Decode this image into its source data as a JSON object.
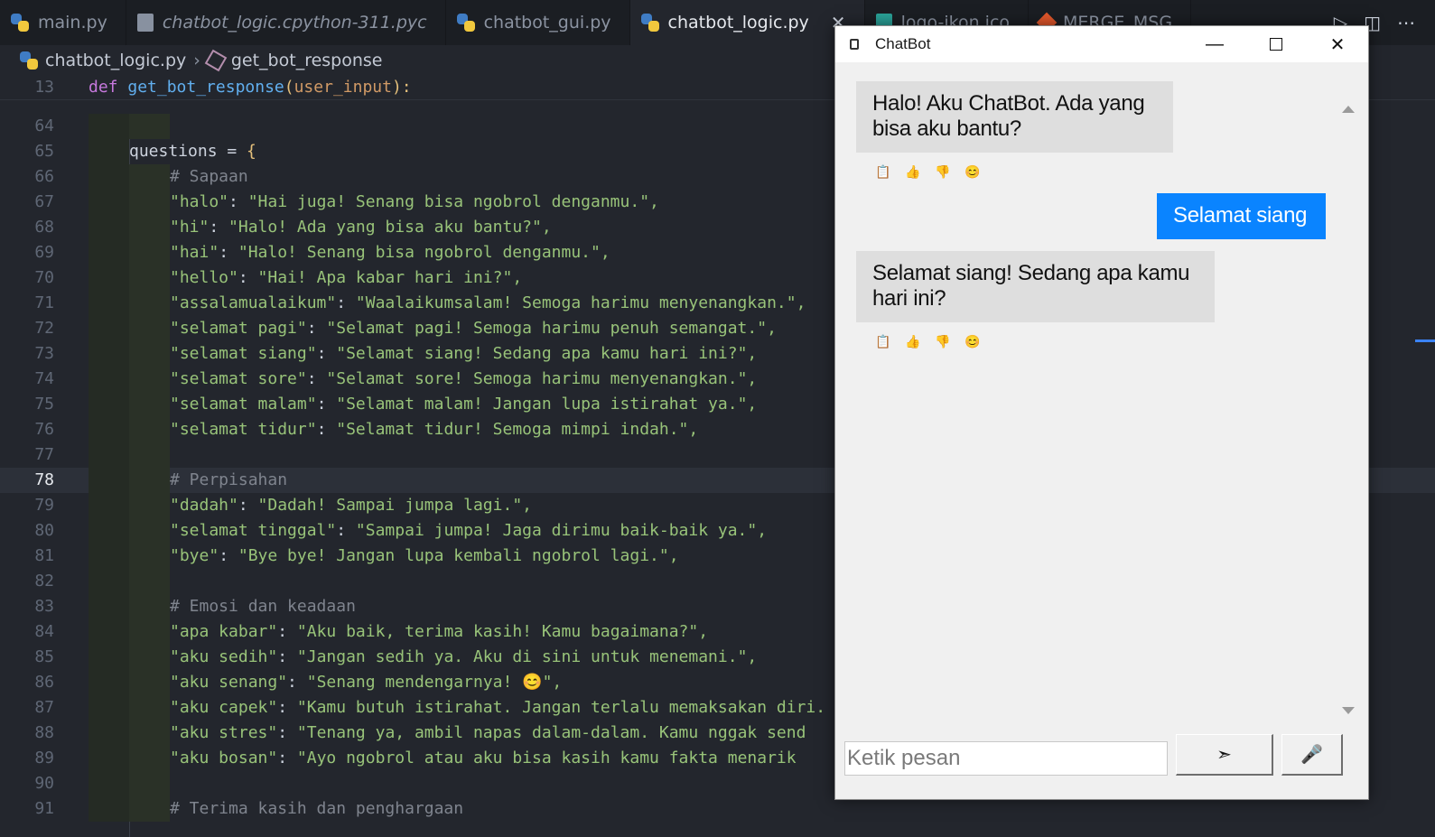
{
  "tabs": [
    {
      "label": "main.py",
      "icon": "python-file-icon",
      "italic": false,
      "active": false
    },
    {
      "label": "chatbot_logic.cpython-311.pyc",
      "icon": "pyc-file-icon",
      "italic": true,
      "active": false
    },
    {
      "label": "chatbot_gui.py",
      "icon": "python-file-icon",
      "italic": false,
      "active": false
    },
    {
      "label": "chatbot_logic.py",
      "icon": "python-file-icon",
      "italic": false,
      "active": true
    },
    {
      "label": "logo-ikon.ico",
      "icon": "ico-file-icon",
      "italic": false,
      "active": false
    },
    {
      "label": "MERGE_MSG",
      "icon": "git-file-icon",
      "italic": false,
      "active": false
    }
  ],
  "breadcrumb": {
    "file": "chatbot_logic.py",
    "symbol": "get_bot_response"
  },
  "editor": {
    "current_line": "78",
    "sticky": {
      "num": "13",
      "kw": "def",
      "fn": "get_bot_response",
      "param": "user_input",
      "tail": "):"
    },
    "lines": [
      {
        "num": "64",
        "code": ""
      },
      {
        "num": "65",
        "code": "questions = {"
      },
      {
        "num": "66",
        "code": "# Sapaan"
      },
      {
        "num": "67",
        "code": "\"halo\": \"Hai juga! Senang bisa ngobrol denganmu.\","
      },
      {
        "num": "68",
        "code": "\"hi\": \"Halo! Ada yang bisa aku bantu?\","
      },
      {
        "num": "69",
        "code": "\"hai\": \"Halo! Senang bisa ngobrol denganmu.\","
      },
      {
        "num": "70",
        "code": "\"hello\": \"Hai! Apa kabar hari ini?\","
      },
      {
        "num": "71",
        "code": "\"assalamualaikum\": \"Waalaikumsalam! Semoga harimu menyenangkan.\","
      },
      {
        "num": "72",
        "code": "\"selamat pagi\": \"Selamat pagi! Semoga harimu penuh semangat.\","
      },
      {
        "num": "73",
        "code": "\"selamat siang\": \"Selamat siang! Sedang apa kamu hari ini?\","
      },
      {
        "num": "74",
        "code": "\"selamat sore\": \"Selamat sore! Semoga harimu menyenangkan.\","
      },
      {
        "num": "75",
        "code": "\"selamat malam\": \"Selamat malam! Jangan lupa istirahat ya.\","
      },
      {
        "num": "76",
        "code": "\"selamat tidur\": \"Selamat tidur! Semoga mimpi indah.\","
      },
      {
        "num": "77",
        "code": ""
      },
      {
        "num": "78",
        "code": "# Perpisahan"
      },
      {
        "num": "79",
        "code": "\"dadah\": \"Dadah! Sampai jumpa lagi.\","
      },
      {
        "num": "80",
        "code": "\"selamat tinggal\": \"Sampai jumpa! Jaga dirimu baik-baik ya.\","
      },
      {
        "num": "81",
        "code": "\"bye\": \"Bye bye! Jangan lupa kembali ngobrol lagi.\","
      },
      {
        "num": "82",
        "code": ""
      },
      {
        "num": "83",
        "code": "# Emosi dan keadaan"
      },
      {
        "num": "84",
        "code": "\"apa kabar\": \"Aku baik, terima kasih! Kamu bagaimana?\","
      },
      {
        "num": "85",
        "code": "\"aku sedih\": \"Jangan sedih ya. Aku di sini untuk menemani.\","
      },
      {
        "num": "86",
        "code": "\"aku senang\": \"Senang mendengarnya! 😊\","
      },
      {
        "num": "87",
        "code": "\"aku capek\": \"Kamu butuh istirahat. Jangan terlalu memaksakan diri."
      },
      {
        "num": "88",
        "code": "\"aku stres\": \"Tenang ya, ambil napas dalam-dalam. Kamu nggak send"
      },
      {
        "num": "89",
        "code": "\"aku bosan\": \"Ayo ngobrol atau aku bisa kasih kamu fakta menarik"
      },
      {
        "num": "90",
        "code": ""
      },
      {
        "num": "91",
        "code": "# Terima kasih dan penghargaan"
      }
    ]
  },
  "chatbot": {
    "title": "ChatBot",
    "minimize": "—",
    "close": "✕",
    "messages": [
      {
        "sender": "bot",
        "text": "Halo! Aku ChatBot. Ada yang bisa aku bantu?"
      },
      {
        "sender": "user",
        "text": "Selamat siang"
      },
      {
        "sender": "bot",
        "text": "Selamat siang! Sedang apa kamu hari ini?"
      }
    ],
    "reaction_icons": [
      "📋",
      "👍",
      "👎",
      "😊"
    ],
    "input_placeholder": "Ketik pesan",
    "send_symbol": "➣",
    "mic_symbol": "🎤"
  },
  "colors": {
    "editor_bg": "#23262d",
    "string": "#98c379",
    "keyword": "#c678dd",
    "function": "#61afef",
    "user_bubble": "#0a84ff",
    "bot_bubble": "#dedede"
  }
}
